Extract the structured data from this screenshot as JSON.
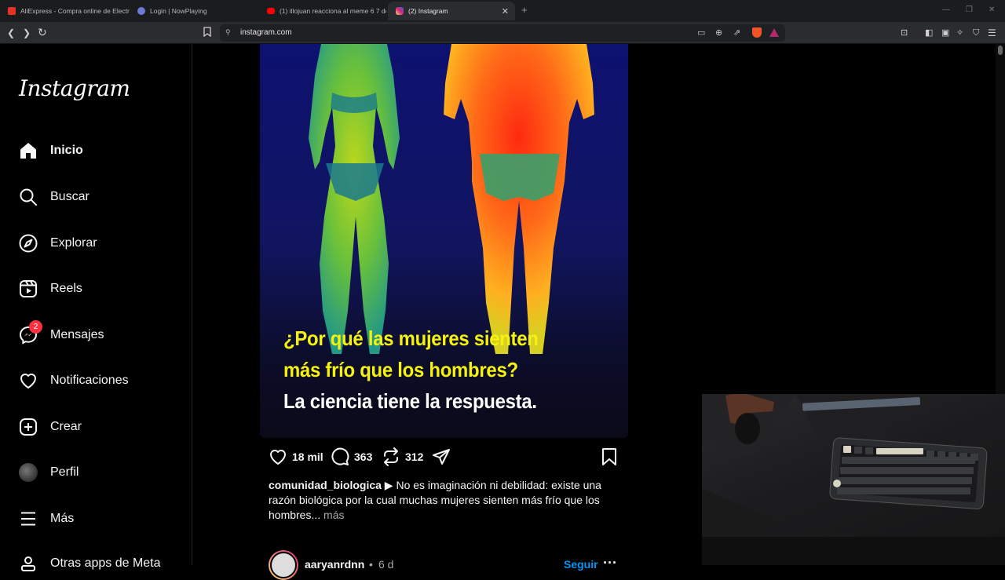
{
  "browser": {
    "tabs": [
      {
        "title": "AliExpress - Compra online de Electr",
        "favicon_color": "#e43225",
        "active": false
      },
      {
        "title": "Login | NowPlaying",
        "favicon_color": "#6c7bd6",
        "active": false
      },
      {
        "title": "(1) illojuan reacciona al meme 6 7 de",
        "favicon_color": "#ff0000",
        "active": false
      },
      {
        "title": "(2) Instagram",
        "favicon_color": "#d62976",
        "active": true
      }
    ],
    "url": "instagram.com"
  },
  "sidebar": {
    "logo": "Instagram",
    "items": [
      {
        "label": "Inicio",
        "icon": "home-icon",
        "active": true
      },
      {
        "label": "Buscar",
        "icon": "search-icon"
      },
      {
        "label": "Explorar",
        "icon": "compass-icon"
      },
      {
        "label": "Reels",
        "icon": "reels-icon"
      },
      {
        "label": "Mensajes",
        "icon": "messenger-icon",
        "badge": "2"
      },
      {
        "label": "Notificaciones",
        "icon": "heart-icon"
      },
      {
        "label": "Crear",
        "icon": "plus-square-icon"
      },
      {
        "label": "Perfil",
        "icon": "avatar"
      },
      {
        "label": "Más",
        "icon": "menu-icon"
      },
      {
        "label": "Otras apps de Meta",
        "icon": "meta-apps-icon"
      }
    ]
  },
  "post": {
    "image_text": {
      "line1": "¿Por qué las mujeres sienten",
      "line2": "más frío que los hombres?",
      "line3": "La ciencia tiene la respuesta."
    },
    "likes": "18 mil",
    "comments": "363",
    "reposts": "312",
    "caption_user": "comunidad_biologica",
    "caption_text": " ▶ No es imaginación ni debilidad: existe una razón biológica por la cual muchas mujeres sienten más frío que los hombres...",
    "caption_more": " más"
  },
  "next_post": {
    "username": "aaryanrdnn",
    "age": "6 d",
    "follow": "Seguir"
  },
  "colors": {
    "accent_blue": "#0095f6",
    "badge_red": "#ff3040",
    "caption_yellow": "#f5f20f"
  }
}
